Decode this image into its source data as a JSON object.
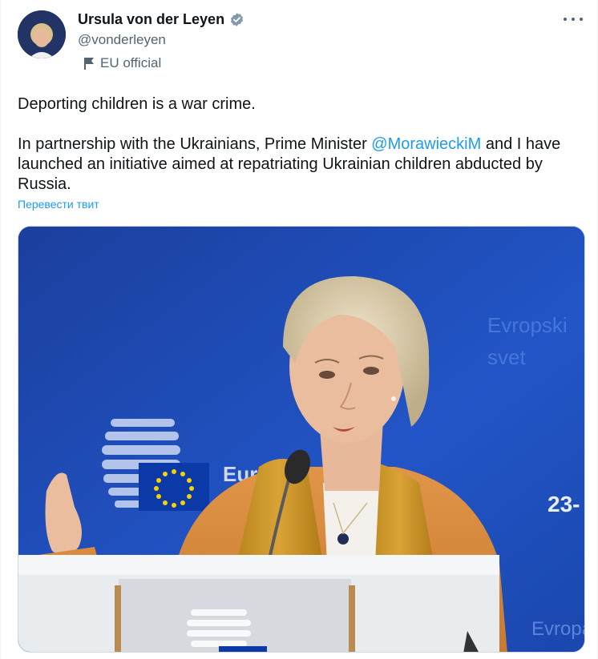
{
  "author": {
    "display_name": "Ursula von der Leyen",
    "handle": "@vonderleyen",
    "affiliation": "EU official"
  },
  "tweet": {
    "line1": "Deporting children is a war crime.",
    "line2_before": "In partnership with the Ukrainians, Prime Minister ",
    "mention": "@MorawieckiM",
    "line2_after": " and I have launched an initiative aimed at repatriating Ukrainian children abducted by Russia.",
    "translate_link": "Перевести твит"
  },
  "media": {
    "backdrop_text_1": "Evropski",
    "backdrop_text_2": "svet",
    "backdrop_logo_text": "Euro",
    "backdrop_date": "23-",
    "backdrop_text_3": "Evropa"
  },
  "colors": {
    "link": "#1d9bf0",
    "secondary_text": "#536471",
    "verified_badge": "#829aab",
    "backdrop_blue": "#1f50c0",
    "jacket_orange": "#d98a3c"
  }
}
